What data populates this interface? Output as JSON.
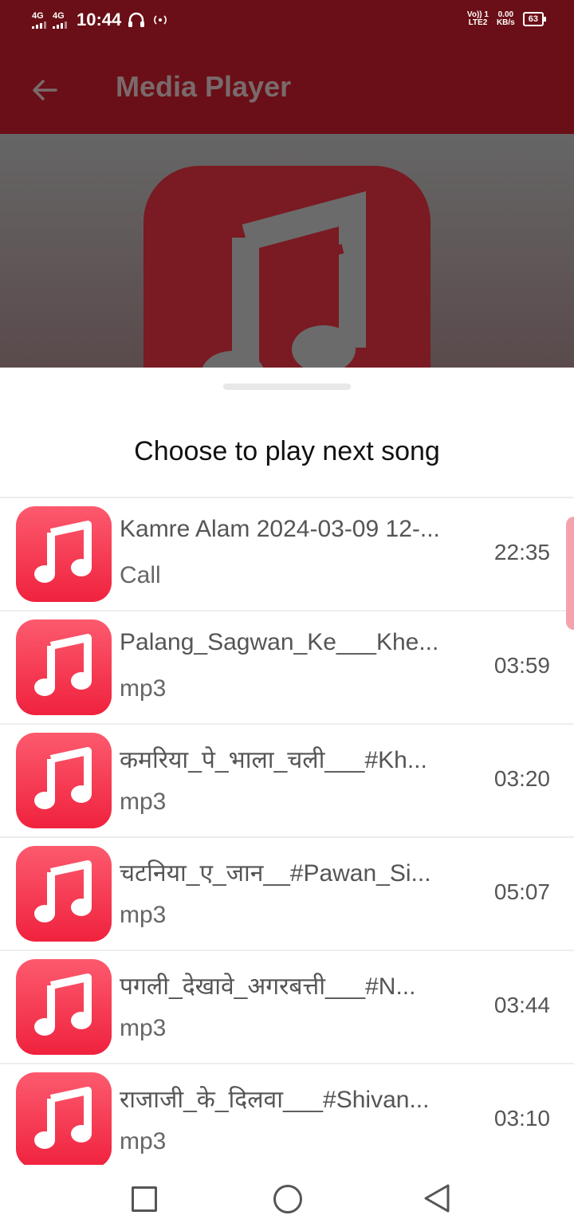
{
  "status_bar": {
    "sim1": "4G",
    "sim2": "4G",
    "time": "10:44",
    "volte": "Vo)) 1",
    "lte": "LTE2",
    "speed_value": "0.00",
    "speed_unit": "KB/s",
    "battery": "63"
  },
  "app_bar": {
    "title": "Media Player",
    "back_icon": "arrow-left-icon"
  },
  "album_art": {
    "icon": "music-note-icon"
  },
  "sheet": {
    "title": "Choose to play next song"
  },
  "songs": [
    {
      "title": "Kamre Alam 2024-03-09 12-...",
      "subtitle": "Call",
      "duration": "22:35"
    },
    {
      "title": "Palang_Sagwan_Ke___Khe...",
      "subtitle": "mp3",
      "duration": "03:59"
    },
    {
      "title": "कमरिया_पे_भाला_चली___#Kh...",
      "subtitle": "mp3",
      "duration": "03:20"
    },
    {
      "title": "चटनिया_ए_जान__#Pawan_Si...",
      "subtitle": "mp3",
      "duration": "05:07"
    },
    {
      "title": "पगली_देखावे_अगरबत्ती___#N...",
      "subtitle": "mp3",
      "duration": "03:44"
    },
    {
      "title": "राजाजी_के_दिलवा___#Shivan...",
      "subtitle": "mp3",
      "duration": "03:10"
    }
  ],
  "nav_bar": {
    "recents_icon": "square-icon",
    "home_icon": "circle-icon",
    "back_icon": "triangle-back-icon"
  },
  "colors": {
    "app_bar": "#6a0f17",
    "accent": "#f0223e"
  }
}
